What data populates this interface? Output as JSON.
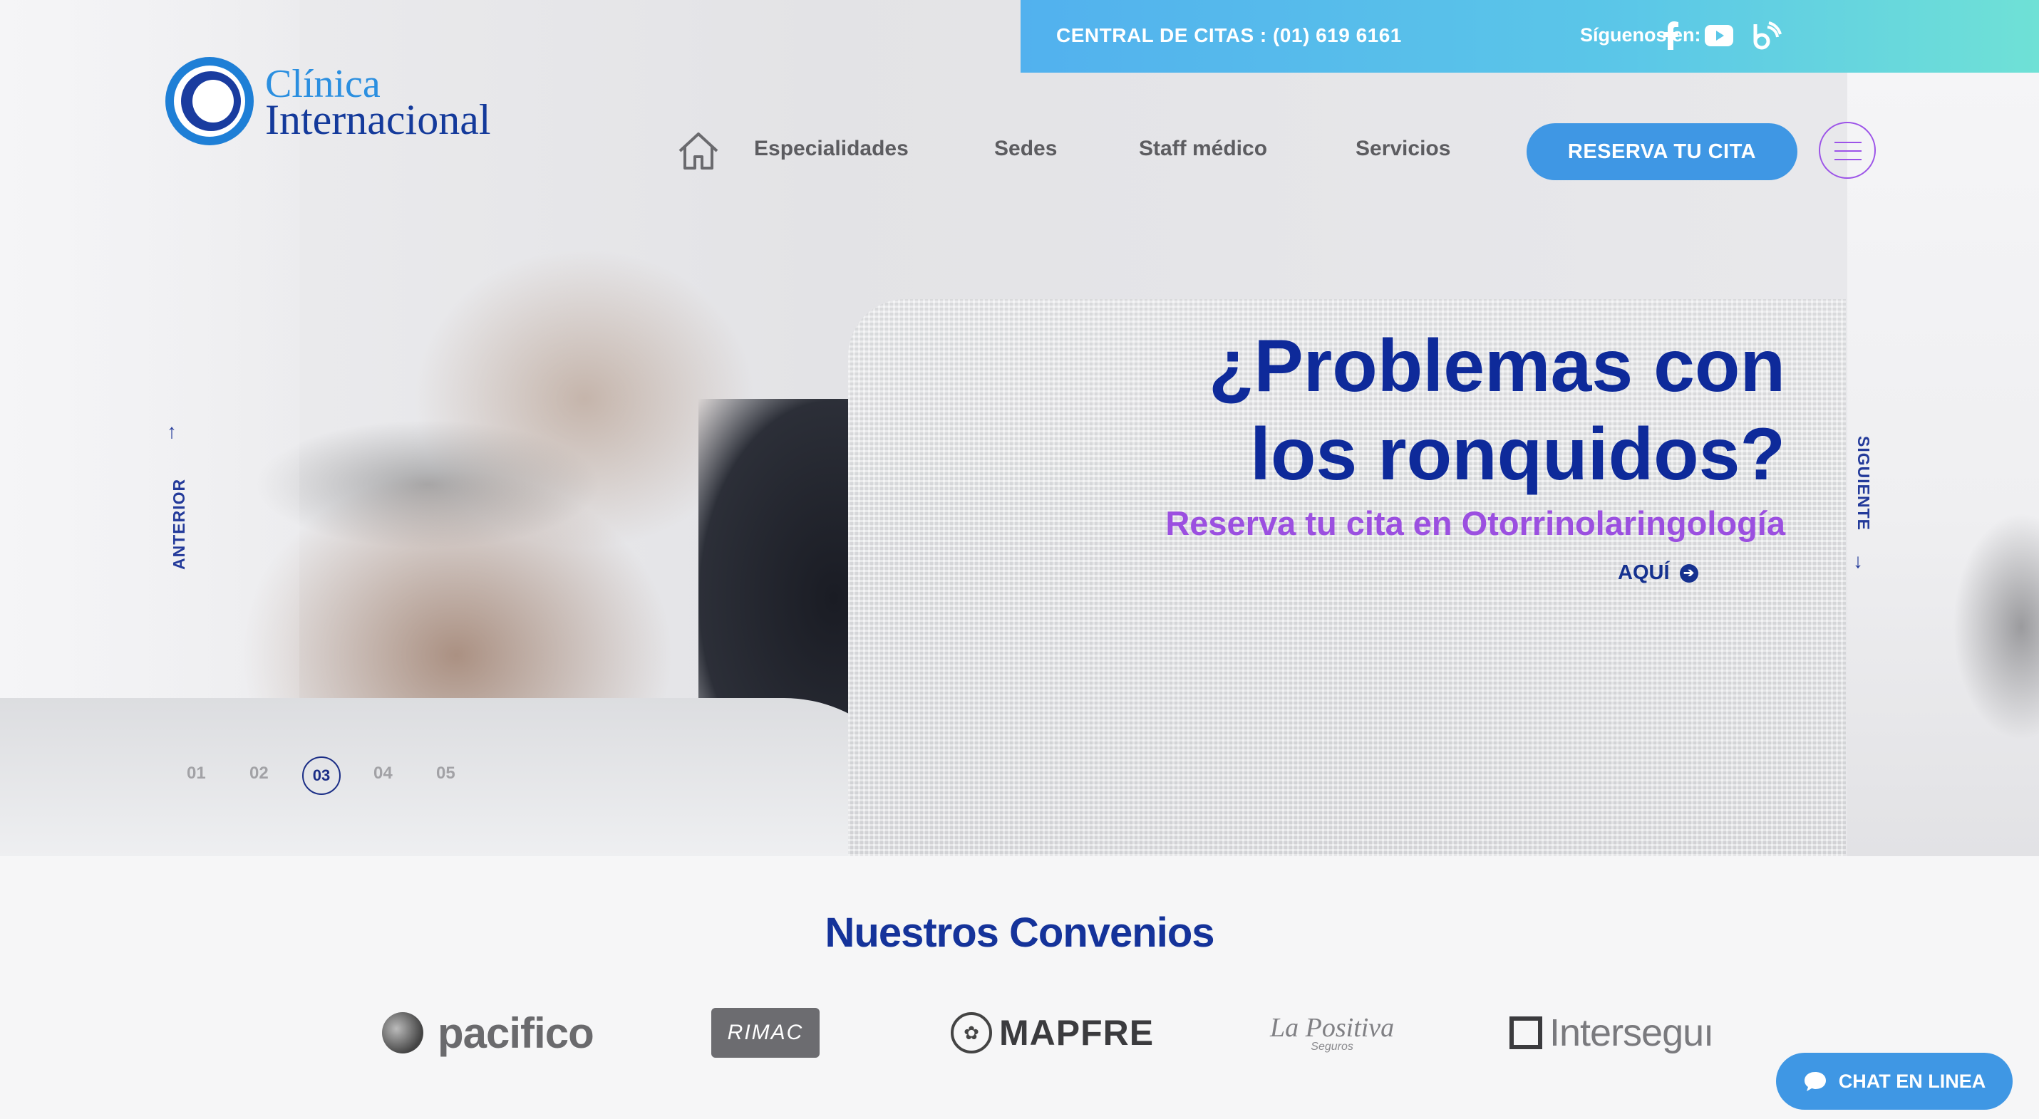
{
  "topbar": {
    "central_label": "CENTRAL DE CITAS : (01) 619 6161",
    "siguenos_label": "Síguenos en:",
    "social_icons": [
      "facebook-icon",
      "youtube-icon",
      "blog-icon"
    ]
  },
  "logo": {
    "line1": "Clínica",
    "line2": "Internacional"
  },
  "nav": {
    "items": [
      {
        "label": "Especialidades"
      },
      {
        "label": "Sedes"
      },
      {
        "label": "Staff médico"
      },
      {
        "label": "Servicios"
      }
    ],
    "reserva_label": "RESERVA TU CITA"
  },
  "hero": {
    "headline_line1": "¿Problemas con",
    "headline_line2": "los ronquidos?",
    "subline": "Reserva tu cita en Otorrinolaringología",
    "cta_label": "AQUÍ",
    "prev_label": "ANTERIOR",
    "next_label": "SIGUIENTE",
    "slides": [
      "01",
      "02",
      "03",
      "04",
      "05"
    ],
    "active_slide": "03"
  },
  "convenios": {
    "title": "Nuestros Convenios",
    "partners": [
      "pacifico",
      "RIMAC",
      "MAPFRE",
      "La Positiva",
      "Seguros",
      "Interseguı"
    ]
  },
  "chat": {
    "label": "CHAT EN LINEA"
  },
  "colors": {
    "primary_blue": "#15339a",
    "button_blue": "#3f97e4",
    "accent_purple": "#9b4fe0",
    "topbar_gradient_start": "#52b1ee",
    "topbar_gradient_end": "#6fe1d6"
  }
}
